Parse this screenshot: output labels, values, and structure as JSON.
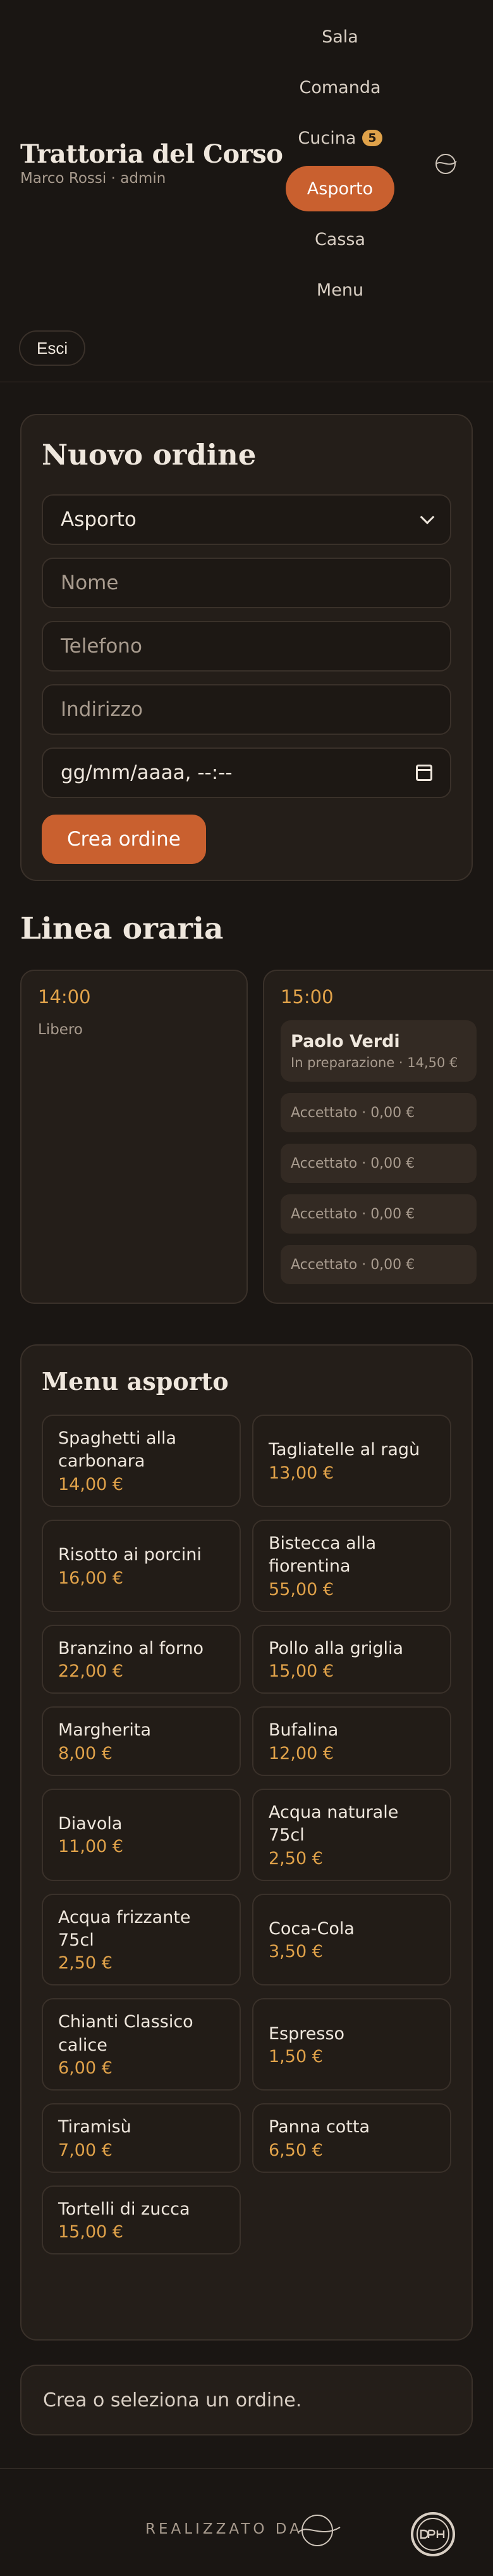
{
  "header": {
    "title": "Trattoria del Corso",
    "user": "Marco Rossi · admin",
    "nav": [
      {
        "label": "Sala"
      },
      {
        "label": "Comanda"
      },
      {
        "label": "Cucina",
        "badge": "5"
      },
      {
        "label": "Asporto",
        "active": true
      },
      {
        "label": "Cassa"
      },
      {
        "label": "Menu"
      }
    ],
    "logout": "Esci"
  },
  "order_form": {
    "title": "Nuovo ordine",
    "type_value": "Asporto",
    "name_placeholder": "Nome",
    "phone_placeholder": "Telefono",
    "address_placeholder": "Indirizzo",
    "datetime_placeholder": "gg/mm/aaaa, --:--",
    "submit": "Crea ordine"
  },
  "timeline": {
    "title": "Linea oraria",
    "col1": {
      "time": "14:00",
      "status": "Libero"
    },
    "col2": {
      "time": "15:00",
      "main": {
        "name": "Paolo Verdi",
        "sub": "In preparazione · 14,50 €"
      },
      "slots": [
        "Accettato · 0,00 €",
        "Accettato · 0,00 €",
        "Accettato · 0,00 €",
        "Accettato · 0,00 €"
      ]
    }
  },
  "menu": {
    "title": "Menu asporto",
    "items": [
      {
        "name": "Spaghetti alla carbonara",
        "price": "14,00 €"
      },
      {
        "name": "Tagliatelle al ragù",
        "price": "13,00 €"
      },
      {
        "name": "Risotto ai porcini",
        "price": "16,00 €"
      },
      {
        "name": "Bistecca alla fiorentina",
        "price": "55,00 €"
      },
      {
        "name": "Branzino al forno",
        "price": "22,00 €"
      },
      {
        "name": "Pollo alla griglia",
        "price": "15,00 €"
      },
      {
        "name": "Margherita",
        "price": "8,00 €"
      },
      {
        "name": "Bufalina",
        "price": "12,00 €"
      },
      {
        "name": "Diavola",
        "price": "11,00 €"
      },
      {
        "name": "Acqua naturale 75cl",
        "price": "2,50 €"
      },
      {
        "name": "Acqua frizzante 75cl",
        "price": "2,50 €"
      },
      {
        "name": "Coca-Cola",
        "price": "3,50 €"
      },
      {
        "name": "Chianti Classico calice",
        "price": "6,00 €"
      },
      {
        "name": "Espresso",
        "price": "1,50 €"
      },
      {
        "name": "Tiramisù",
        "price": "7,00 €"
      },
      {
        "name": "Panna cotta",
        "price": "6,50 €"
      },
      {
        "name": "Tortelli di zucca",
        "price": "15,00 €"
      }
    ]
  },
  "status_message": "Crea o seleziona un ordine.",
  "footer": {
    "made_by": "REALIZZATO DA"
  },
  "colors": {
    "accent": "#c9602f",
    "gold": "#e0a24a",
    "background": "#1a1613"
  }
}
